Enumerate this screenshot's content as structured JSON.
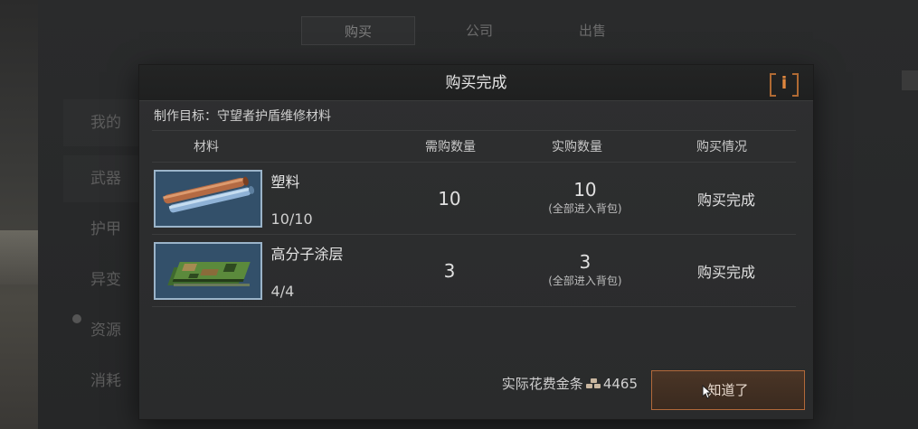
{
  "background": {
    "tabs": [
      "购买",
      "公司",
      "出售"
    ],
    "sidebar": [
      "我的",
      "武器",
      "护甲",
      "异变",
      "资源",
      "消耗"
    ]
  },
  "modal": {
    "title": "购买完成",
    "info_icon_glyph": "i",
    "target_label": "制作目标：守望者护盾维修材料",
    "columns": {
      "material": "材料",
      "need": "需购数量",
      "real": "实购数量",
      "status": "购买情况"
    },
    "rows": [
      {
        "name": "塑料",
        "count": "10/10",
        "need": "10",
        "real": "10",
        "real_note": "(全部进入背包)",
        "status": "购买完成",
        "icon": "plastic-rods-icon"
      },
      {
        "name": "高分子涂层",
        "count": "4/4",
        "need": "3",
        "real": "3",
        "real_note": "(全部进入背包)",
        "status": "购买完成",
        "icon": "polymer-coating-icon"
      }
    ],
    "cost_label": "实际花费金条",
    "cost_value": "4465",
    "confirm_label": "知道了"
  },
  "colors": {
    "accent": "#b2693a",
    "thumb_border": "#9bb4c9",
    "thumb_bg": "#39536c"
  }
}
